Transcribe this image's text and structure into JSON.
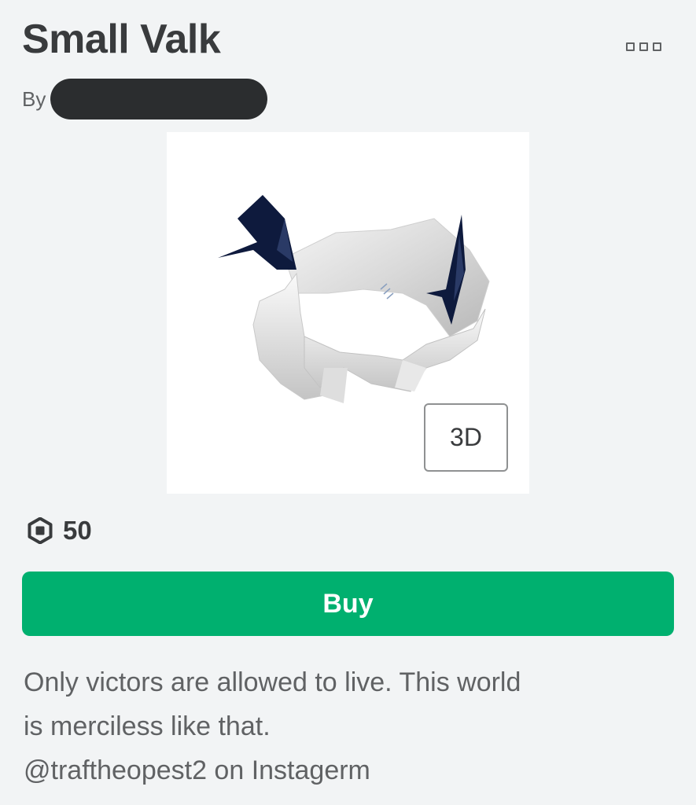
{
  "item": {
    "title": "Small Valk",
    "by_label": "By",
    "creator_name": "[redacted]",
    "view_3d_label": "3D",
    "currency_icon": "robux-icon",
    "price": "50",
    "buy_label": "Buy",
    "description_lines": [
      "Only victors are allowed to live. This world",
      "is merciless like that.",
      "@traftheopest2 on Instagerm"
    ]
  },
  "colors": {
    "buy_green": "#00b06f",
    "text_primary": "#393b3d",
    "text_secondary": "#606264",
    "redaction": "#2b2d2f",
    "wing_navy": "#0e1a3d"
  }
}
